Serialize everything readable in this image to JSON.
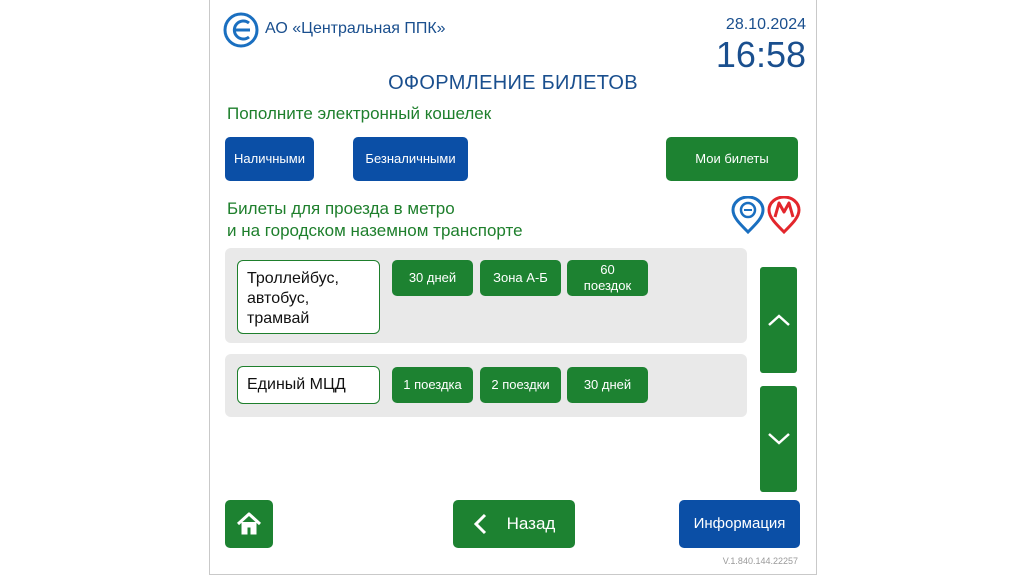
{
  "header": {
    "company": "АО «Центральная ППК»",
    "date": "28.10.2024",
    "time": "16:58"
  },
  "page_title": "ОФОРМЛЕНИЕ БИЛЕТОВ",
  "wallet": {
    "prompt": "Пополните электронный кошелек",
    "cash_label": "Наличными",
    "cashless_label": "Безналичными",
    "my_tickets_label": "Мои билеты"
  },
  "section": {
    "line1": "Билеты для проезда в метро",
    "line2": "и на городском наземном транспорте"
  },
  "rows": [
    {
      "name_lines": [
        "Троллейбус,",
        "автобус,",
        "трамвай"
      ],
      "options": [
        "30 дней",
        "Зона А-Б",
        "60\nпоездок"
      ]
    },
    {
      "name_lines": [
        "Единый МЦД"
      ],
      "options": [
        "1 поездка",
        "2 поездки",
        "30 дней"
      ]
    }
  ],
  "footer": {
    "back_label": "Назад",
    "info_label": "Информация",
    "version": "V.1.840.144.22257"
  },
  "colors": {
    "blue": "#0b4fa6",
    "green": "#1d8231",
    "heading_blue": "#1a4f8e",
    "text_green": "#1e7f2c",
    "mcd_icon": "#1a6fc0",
    "metro_icon": "#e3262c"
  },
  "icons": [
    "company-logo-icon",
    "mcd-icon",
    "metro-icon",
    "chevron-up-icon",
    "chevron-down-icon",
    "home-icon",
    "chevron-left-icon"
  ]
}
